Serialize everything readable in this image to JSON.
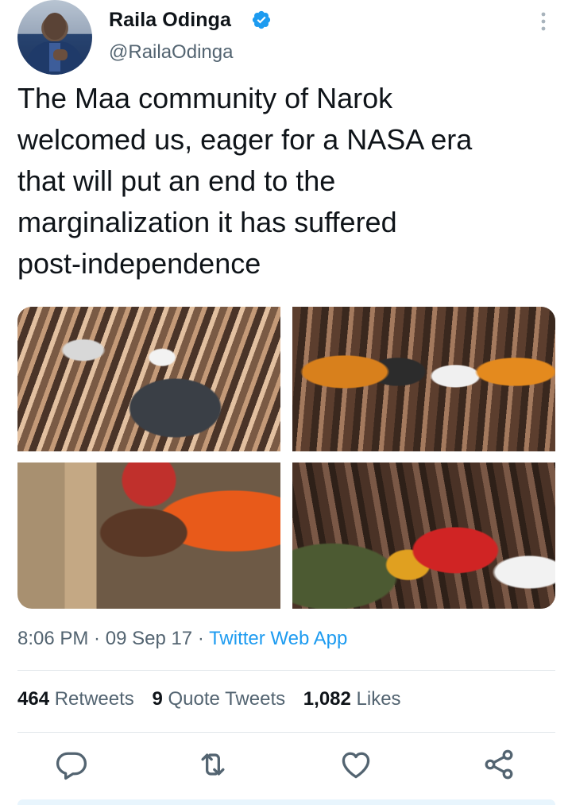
{
  "author": {
    "name": "Raila Odinga",
    "handle": "@RailaOdinga",
    "verified_icon": "verified-badge-icon"
  },
  "tweet": {
    "text": "The Maa community of Narok\nwelcomed us, eager for a NASA era\nthat will put an end to the\nmarginalization it has suffered\npost-independence"
  },
  "media": {
    "photos": [
      "rally-crowd-photo",
      "leaders-dancing-photo",
      "elder-embrace-photo",
      "crowd-cheering-photo"
    ]
  },
  "meta": {
    "time": "8:06 PM",
    "sep1": " · ",
    "date": "09 Sep 17",
    "sep2": " · ",
    "source": "Twitter Web App"
  },
  "stats": {
    "retweets_count": "464",
    "retweets_label": "Retweets",
    "quotes_count": "9",
    "quotes_label": "Quote Tweets",
    "likes_count": "1,082",
    "likes_label": "Likes"
  },
  "actions": [
    "reply-icon",
    "retweet-icon",
    "like-icon",
    "share-icon"
  ],
  "colors": {
    "accent": "#1d9bf0",
    "text": "#0f1419",
    "secondary": "#536471",
    "action_icon": "#536471"
  }
}
